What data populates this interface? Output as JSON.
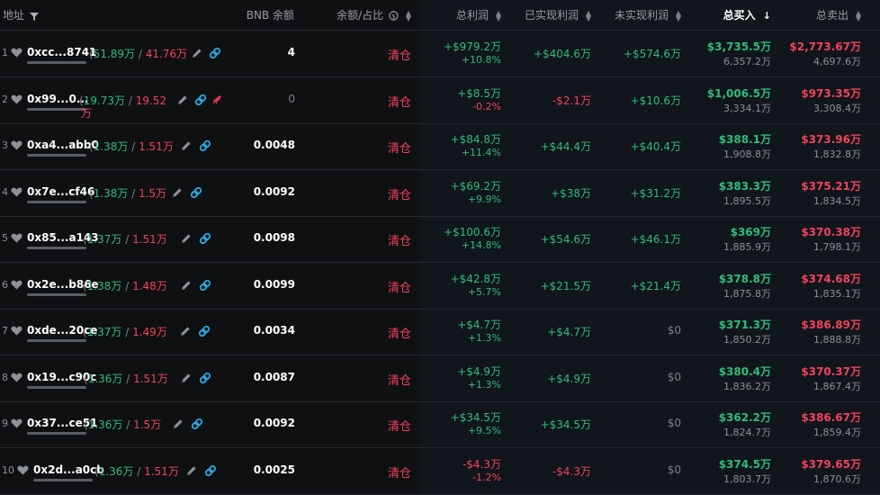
{
  "header": {
    "address": "地址",
    "bnb_balance": "BNB 余额",
    "balance_pct": "余额/占比",
    "total_profit": "总利润",
    "realized": "已实现利润",
    "unrealized": "未实现利润",
    "total_buy": "总买入",
    "total_sell": "总卖出"
  },
  "icons": {
    "filter": "filter-icon",
    "info": "info-circle-icon",
    "heart": "heart-icon",
    "edit": "pencil-icon",
    "link": "chain-link-icon",
    "rocket": "rocket-icon",
    "sort": "sort-arrows-icon"
  },
  "colors": {
    "profit": "#2fbd7a",
    "loss": "#f0445a",
    "link_icon": "#2aa7e0",
    "background": "#0f1012"
  },
  "rows": [
    {
      "idx": "1",
      "address": "0xcc...8741",
      "bought": "51.89万",
      "sep": " / ",
      "sold": "41.76万",
      "bnb": "4",
      "balance": "清仓",
      "tp_usd": "+$979.2万",
      "tp_pct": "+10.8%",
      "realized": "+$404.6万",
      "unrealized": "+$574.6万",
      "buy_usd": "$3,735.5万",
      "buy_tok": "6,357.2万",
      "sell_usd": "$2,773.67万",
      "sell_tok": "4,697.6万"
    },
    {
      "idx": "2",
      "address": "0x99...0...",
      "bought": "19.73万",
      "sep": " / ",
      "sold": "19.52",
      "sold2": "万",
      "bnb": "0",
      "balance": "清仓",
      "tp_usd": "+$8.5万",
      "tp_pct": "-0.2%",
      "realized": "-$2.1万",
      "unrealized": "+$10.6万",
      "buy_usd": "$1,006.5万",
      "buy_tok": "3,334.1万",
      "sell_usd": "$973.35万",
      "sell_tok": "3,308.4万"
    },
    {
      "idx": "3",
      "address": "0xa4...abb0",
      "bought": "1.38万",
      "sep": " / ",
      "sold": "1.51万",
      "bnb": "0.0048",
      "balance": "清仓",
      "tp_usd": "+$84.8万",
      "tp_pct": "+11.4%",
      "realized": "+$44.4万",
      "unrealized": "+$40.4万",
      "buy_usd": "$388.1万",
      "buy_tok": "1,908.8万",
      "sell_usd": "$373.96万",
      "sell_tok": "1,832.8万"
    },
    {
      "idx": "4",
      "address": "0x7e...cf46",
      "bought": "1.38万",
      "sep": " / ",
      "sold": "1.5万",
      "bnb": "0.0092",
      "balance": "清仓",
      "tp_usd": "+$69.2万",
      "tp_pct": "+9.9%",
      "realized": "+$38万",
      "unrealized": "+$31.2万",
      "buy_usd": "$383.3万",
      "buy_tok": "1,895.5万",
      "sell_usd": "$375.21万",
      "sell_tok": "1,834.5万"
    },
    {
      "idx": "5",
      "address": "0x85...a143",
      "bought": "1.37万",
      "sep": " / ",
      "sold": "1.51万",
      "bnb": "0.0098",
      "balance": "清仓",
      "tp_usd": "+$100.6万",
      "tp_pct": "+14.8%",
      "realized": "+$54.6万",
      "unrealized": "+$46.1万",
      "buy_usd": "$369万",
      "buy_tok": "1,885.9万",
      "sell_usd": "$370.38万",
      "sell_tok": "1,798.1万"
    },
    {
      "idx": "6",
      "address": "0x2e...b86e",
      "bought": "1.38万",
      "sep": " / ",
      "sold": "1.48万",
      "bnb": "0.0099",
      "balance": "清仓",
      "tp_usd": "+$42.8万",
      "tp_pct": "+5.7%",
      "realized": "+$21.5万",
      "unrealized": "+$21.4万",
      "buy_usd": "$378.8万",
      "buy_tok": "1,875.8万",
      "sell_usd": "$374.68万",
      "sell_tok": "1,835.1万"
    },
    {
      "idx": "7",
      "address": "0xde...20ce",
      "bought": "1.37万",
      "sep": " / ",
      "sold": "1.49万",
      "bnb": "0.0034",
      "balance": "清仓",
      "tp_usd": "+$4.7万",
      "tp_pct": "+1.3%",
      "realized": "+$4.7万",
      "unrealized": "$0",
      "buy_usd": "$371.3万",
      "buy_tok": "1,850.2万",
      "sell_usd": "$386.89万",
      "sell_tok": "1,888.8万"
    },
    {
      "idx": "8",
      "address": "0x19...c90c",
      "bought": "1.36万",
      "sep": " / ",
      "sold": "1.51万",
      "bnb": "0.0087",
      "balance": "清仓",
      "tp_usd": "+$4.9万",
      "tp_pct": "+1.3%",
      "realized": "+$4.9万",
      "unrealized": "$0",
      "buy_usd": "$380.4万",
      "buy_tok": "1,836.2万",
      "sell_usd": "$370.37万",
      "sell_tok": "1,867.4万"
    },
    {
      "idx": "9",
      "address": "0x37...ce51",
      "bought": "1.36万",
      "sep": " / ",
      "sold": "1.5万",
      "bnb": "0.0092",
      "balance": "清仓",
      "tp_usd": "+$34.5万",
      "tp_pct": "+9.5%",
      "realized": "+$34.5万",
      "unrealized": "$0",
      "buy_usd": "$362.2万",
      "buy_tok": "1,824.7万",
      "sell_usd": "$386.67万",
      "sell_tok": "1,859.4万"
    },
    {
      "idx": "10",
      "address": "0x2d...a0cb",
      "bought": "1.36万",
      "sep": " / ",
      "sold": "1.51万",
      "bnb": "0.0025",
      "balance": "清仓",
      "tp_usd": "-$4.3万",
      "tp_pct": "-1.2%",
      "realized": "-$4.3万",
      "unrealized": "$0",
      "buy_usd": "$374.5万",
      "buy_tok": "1,803.7万",
      "sell_usd": "$379.65万",
      "sell_tok": "1,870.6万"
    }
  ]
}
